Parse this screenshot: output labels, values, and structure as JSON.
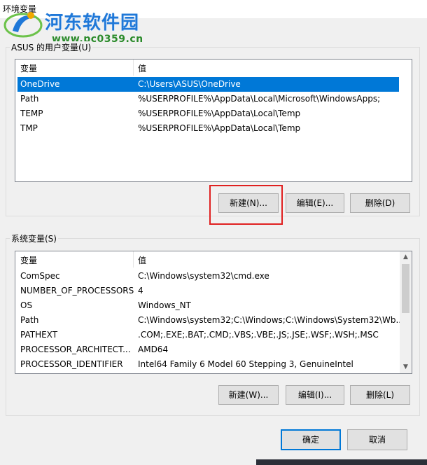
{
  "window": {
    "title": "环境变量"
  },
  "watermark": {
    "name": "河东软件园",
    "url": "www.pc0359.cn"
  },
  "user_vars": {
    "group_label": "ASUS 的用户变量(U)",
    "columns": [
      "变量",
      "值"
    ],
    "rows": [
      {
        "name": "OneDrive",
        "value": "C:\\Users\\ASUS\\OneDrive",
        "selected": true
      },
      {
        "name": "Path",
        "value": "%USERPROFILE%\\AppData\\Local\\Microsoft\\WindowsApps;"
      },
      {
        "name": "TEMP",
        "value": "%USERPROFILE%\\AppData\\Local\\Temp"
      },
      {
        "name": "TMP",
        "value": "%USERPROFILE%\\AppData\\Local\\Temp"
      }
    ],
    "buttons": {
      "new": "新建(N)...",
      "edit": "编辑(E)...",
      "delete": "删除(D)"
    }
  },
  "system_vars": {
    "group_label": "系统变量(S)",
    "columns": [
      "变量",
      "值"
    ],
    "rows": [
      {
        "name": "ComSpec",
        "value": "C:\\Windows\\system32\\cmd.exe"
      },
      {
        "name": "NUMBER_OF_PROCESSORS",
        "value": "4"
      },
      {
        "name": "OS",
        "value": "Windows_NT"
      },
      {
        "name": "Path",
        "value": "C:\\Windows\\system32;C:\\Windows;C:\\Windows\\System32\\Wb..."
      },
      {
        "name": "PATHEXT",
        "value": ".COM;.EXE;.BAT;.CMD;.VBS;.VBE;.JS;.JSE;.WSF;.WSH;.MSC"
      },
      {
        "name": "PROCESSOR_ARCHITECT...",
        "value": "AMD64"
      },
      {
        "name": "PROCESSOR_IDENTIFIER",
        "value": "Intel64 Family 6 Model 60 Stepping 3, GenuineIntel"
      }
    ],
    "buttons": {
      "new": "新建(W)...",
      "edit": "编辑(I)...",
      "delete": "删除(L)"
    }
  },
  "dialog_buttons": {
    "ok": "确定",
    "cancel": "取消"
  },
  "colors": {
    "selection": "#0078d7",
    "highlight_box": "#e02020",
    "watermark_text": "#1f78d8",
    "watermark_url": "#2a8a2a"
  }
}
